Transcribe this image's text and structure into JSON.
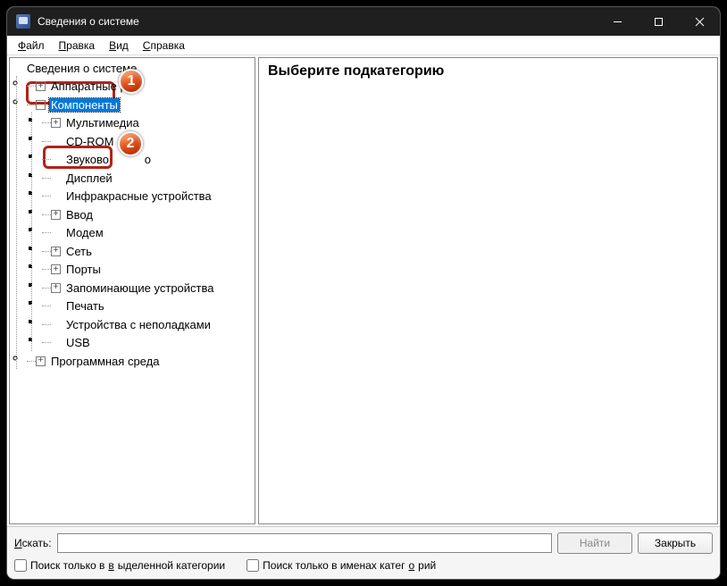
{
  "window": {
    "title": "Сведения о системе"
  },
  "menu": {
    "file": "Файл",
    "edit": "Правка",
    "view": "Вид",
    "help": "Справка",
    "file_u": "Ф",
    "edit_u": "П",
    "view_u": "В",
    "help_u": "С"
  },
  "tree": {
    "root": "Сведения о системе",
    "hardware": "Аппаратные р",
    "components": "Компоненты",
    "multimedia": "Мультимедиа",
    "cdrom": "CD-ROM",
    "audio": "Звуково",
    "audio_tail": "о",
    "display": "Дисплей",
    "infrared": "Инфракрасные устройства",
    "input": "Ввод",
    "modem": "Модем",
    "network": "Сеть",
    "ports": "Порты",
    "storage": "Запоминающие устройства",
    "printing": "Печать",
    "problem_devices": "Устройства с неполадками",
    "usb": "USB",
    "software_env": "Программная среда"
  },
  "detail": {
    "heading": "Выберите подкатегорию"
  },
  "search": {
    "label": "Искать:",
    "find": "Найти",
    "close": "Закрыть",
    "only_selected": "Поиск только в выделенной категории",
    "only_names": "Поиск только в именах категорий"
  },
  "callouts": {
    "one": "1",
    "two": "2"
  }
}
